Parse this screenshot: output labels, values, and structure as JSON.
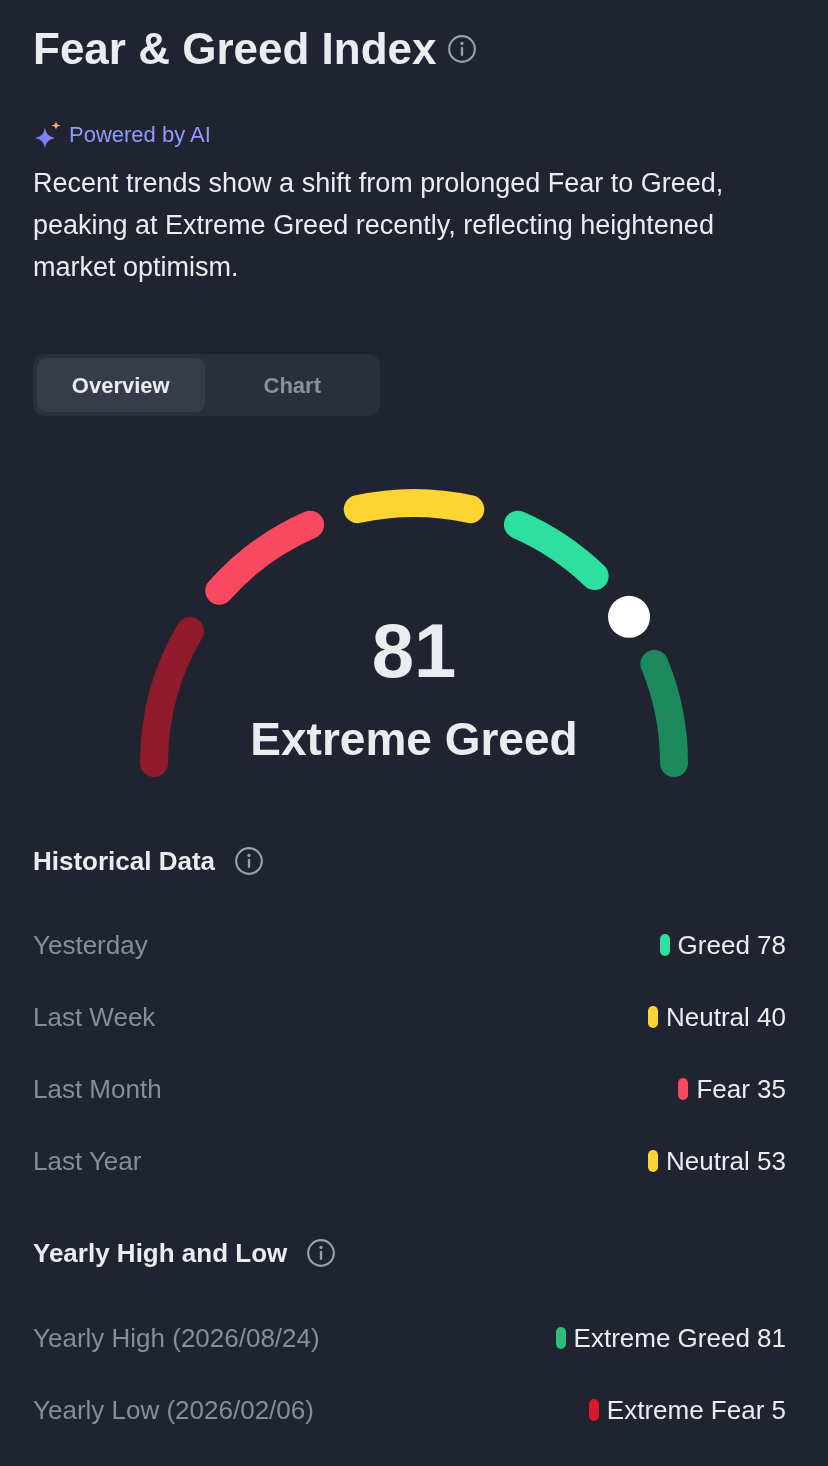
{
  "header": {
    "title": "Fear & Greed Index"
  },
  "ai_summary": {
    "label": "Powered by AI",
    "text": "Recent trends show a shift from prolonged Fear to Greed, peaking at Extreme Greed recently, reflecting heightened market optimism."
  },
  "tabs": [
    {
      "label": "Overview",
      "selected": true
    },
    {
      "label": "Chart",
      "selected": false
    }
  ],
  "gauge": {
    "value": "81",
    "classification": "Extreme Greed",
    "level": 0.81
  },
  "sections": [
    {
      "title": "Historical Data",
      "rows": [
        {
          "label": "Yesterday",
          "value": "Greed 78",
          "color": "#2ee0a0"
        },
        {
          "label": "Last Week",
          "value": "Neutral 40",
          "color": "#fcd535"
        },
        {
          "label": "Last Month",
          "value": "Fear 35",
          "color": "#f84960"
        },
        {
          "label": "Last Year",
          "value": "Neutral 53",
          "color": "#fcd535"
        }
      ]
    },
    {
      "title": "Yearly High and Low",
      "rows": [
        {
          "label": "Yearly High (2026/08/24)",
          "value": "Extreme Greed 81",
          "color": "#2ebd7f"
        },
        {
          "label": "Yearly Low (2026/02/06)",
          "value": "Extreme Fear 5",
          "color": "#d9182c"
        }
      ]
    }
  ]
}
